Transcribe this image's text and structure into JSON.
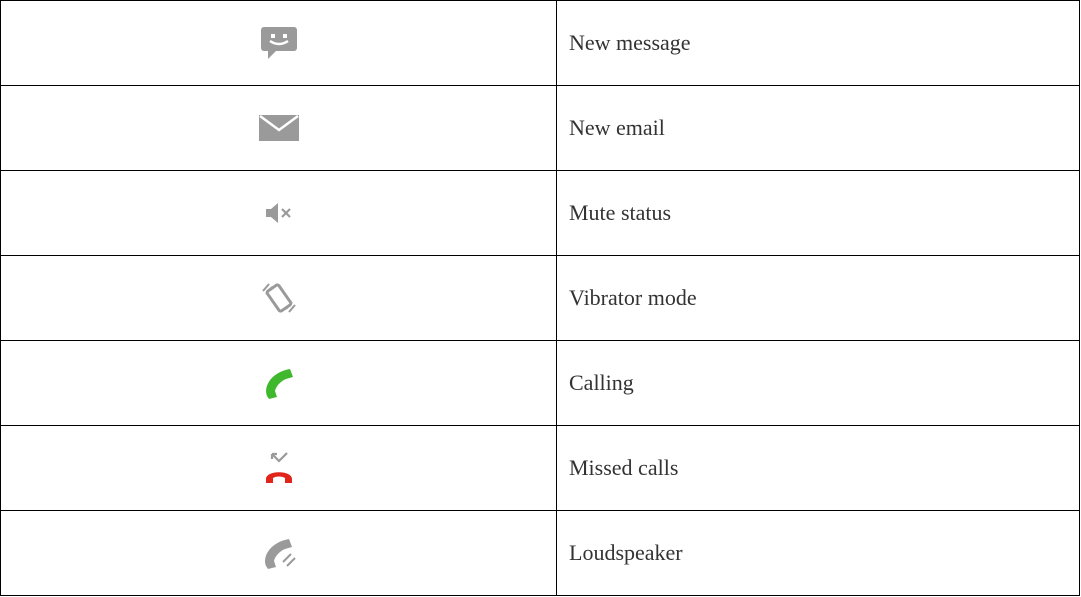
{
  "rows": [
    {
      "icon": "smiley-message-icon",
      "label": "New message"
    },
    {
      "icon": "envelope-icon",
      "label": "New email"
    },
    {
      "icon": "speaker-mute-icon",
      "label": "Mute status"
    },
    {
      "icon": "vibrate-phone-icon",
      "label": "Vibrator mode"
    },
    {
      "icon": "phone-call-icon",
      "label": "Calling"
    },
    {
      "icon": "missed-call-icon",
      "label": "Missed calls"
    },
    {
      "icon": "speakerphone-icon",
      "label": "Loudspeaker"
    }
  ],
  "colors": {
    "icon_gray": "#9a9a9a",
    "call_green": "#3fb82e",
    "missed_red": "#e0251b",
    "text": "#333333",
    "border": "#000000"
  }
}
